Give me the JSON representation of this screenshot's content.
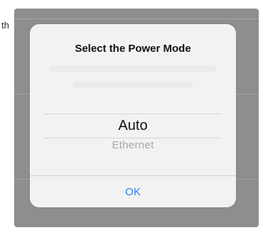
{
  "background": {
    "edge_text": "th"
  },
  "dialog": {
    "title": "Select the Power Mode",
    "picker": {
      "selected": "Auto",
      "next_option": "Ethernet"
    },
    "ok_label": "OK"
  },
  "colors": {
    "accent": "#2a7bf0",
    "overlay": "#8e8e8e",
    "dialog_background": "#f2f2f2"
  }
}
